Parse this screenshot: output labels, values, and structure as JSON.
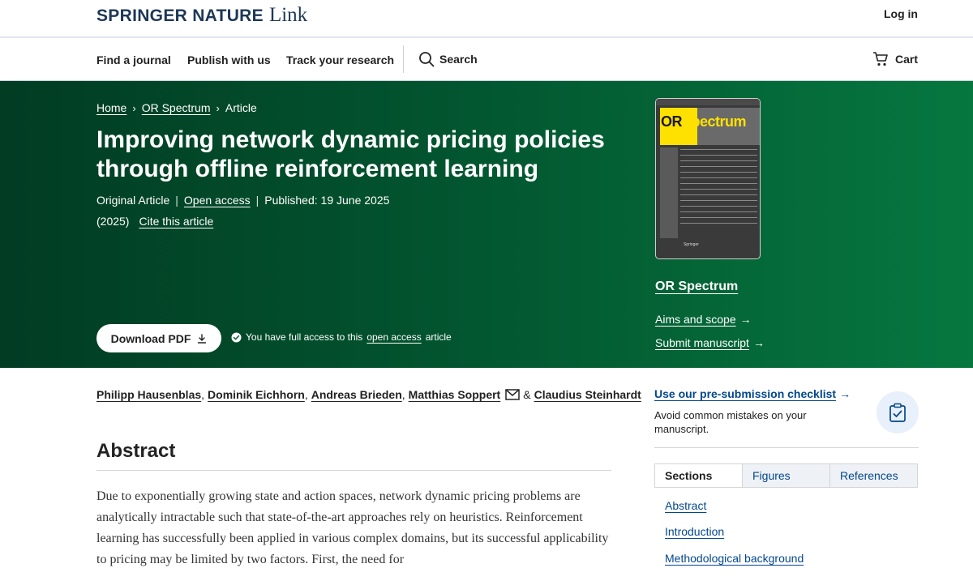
{
  "header": {
    "brand": "SPRINGER NATURE",
    "brand_suffix": "Link",
    "login": "Log in"
  },
  "nav": {
    "items": [
      "Find a journal",
      "Publish with us",
      "Track your research"
    ],
    "search": "Search",
    "cart": "Cart"
  },
  "breadcrumb": [
    "Home",
    "OR Spectrum",
    "Article"
  ],
  "article": {
    "title": "Improving network dynamic pricing policies through offline reinforcement learning",
    "type": "Original Article",
    "access": "Open access",
    "published": "Published: 19 June 2025",
    "year": "(2025)",
    "cite": "Cite this article",
    "download": "Download PDF",
    "access_prefix": "You have full access to this",
    "access_link": "open access",
    "access_suffix": "article"
  },
  "journal": {
    "cover_title_or": "OR",
    "cover_title_spectrum": "Spectrum",
    "cover_publisher": "Springer",
    "name": "OR Spectrum",
    "aims": "Aims and scope",
    "submit": "Submit manuscript"
  },
  "authors": [
    "Philipp Hausenblas",
    "Dominik Eichhorn",
    "Andreas Brieden",
    "Matthias Soppert",
    "Claudius Steinhardt"
  ],
  "authors_amp": "&",
  "abstract": {
    "heading": "Abstract",
    "text": "Due to exponentially growing state and action spaces, network dynamic pricing problems are analytically intractable such that state-of-the-art approaches rely on heuristics. Reinforcement learning has successfully been applied in various complex domains, but its successful applicability to pricing may be limited by two factors. First, the need for"
  },
  "sidebar": {
    "checklist": "Use our pre-submission checklist",
    "checklist_desc": "Avoid common mistakes on your manuscript.",
    "tabs": [
      "Sections",
      "Figures",
      "References"
    ],
    "sections": [
      "Abstract",
      "Introduction",
      "Methodological background"
    ]
  },
  "colors": {
    "hero_start": "#013c23",
    "hero_end": "#06773f",
    "link": "#02478d",
    "brand": "#1d3757"
  }
}
